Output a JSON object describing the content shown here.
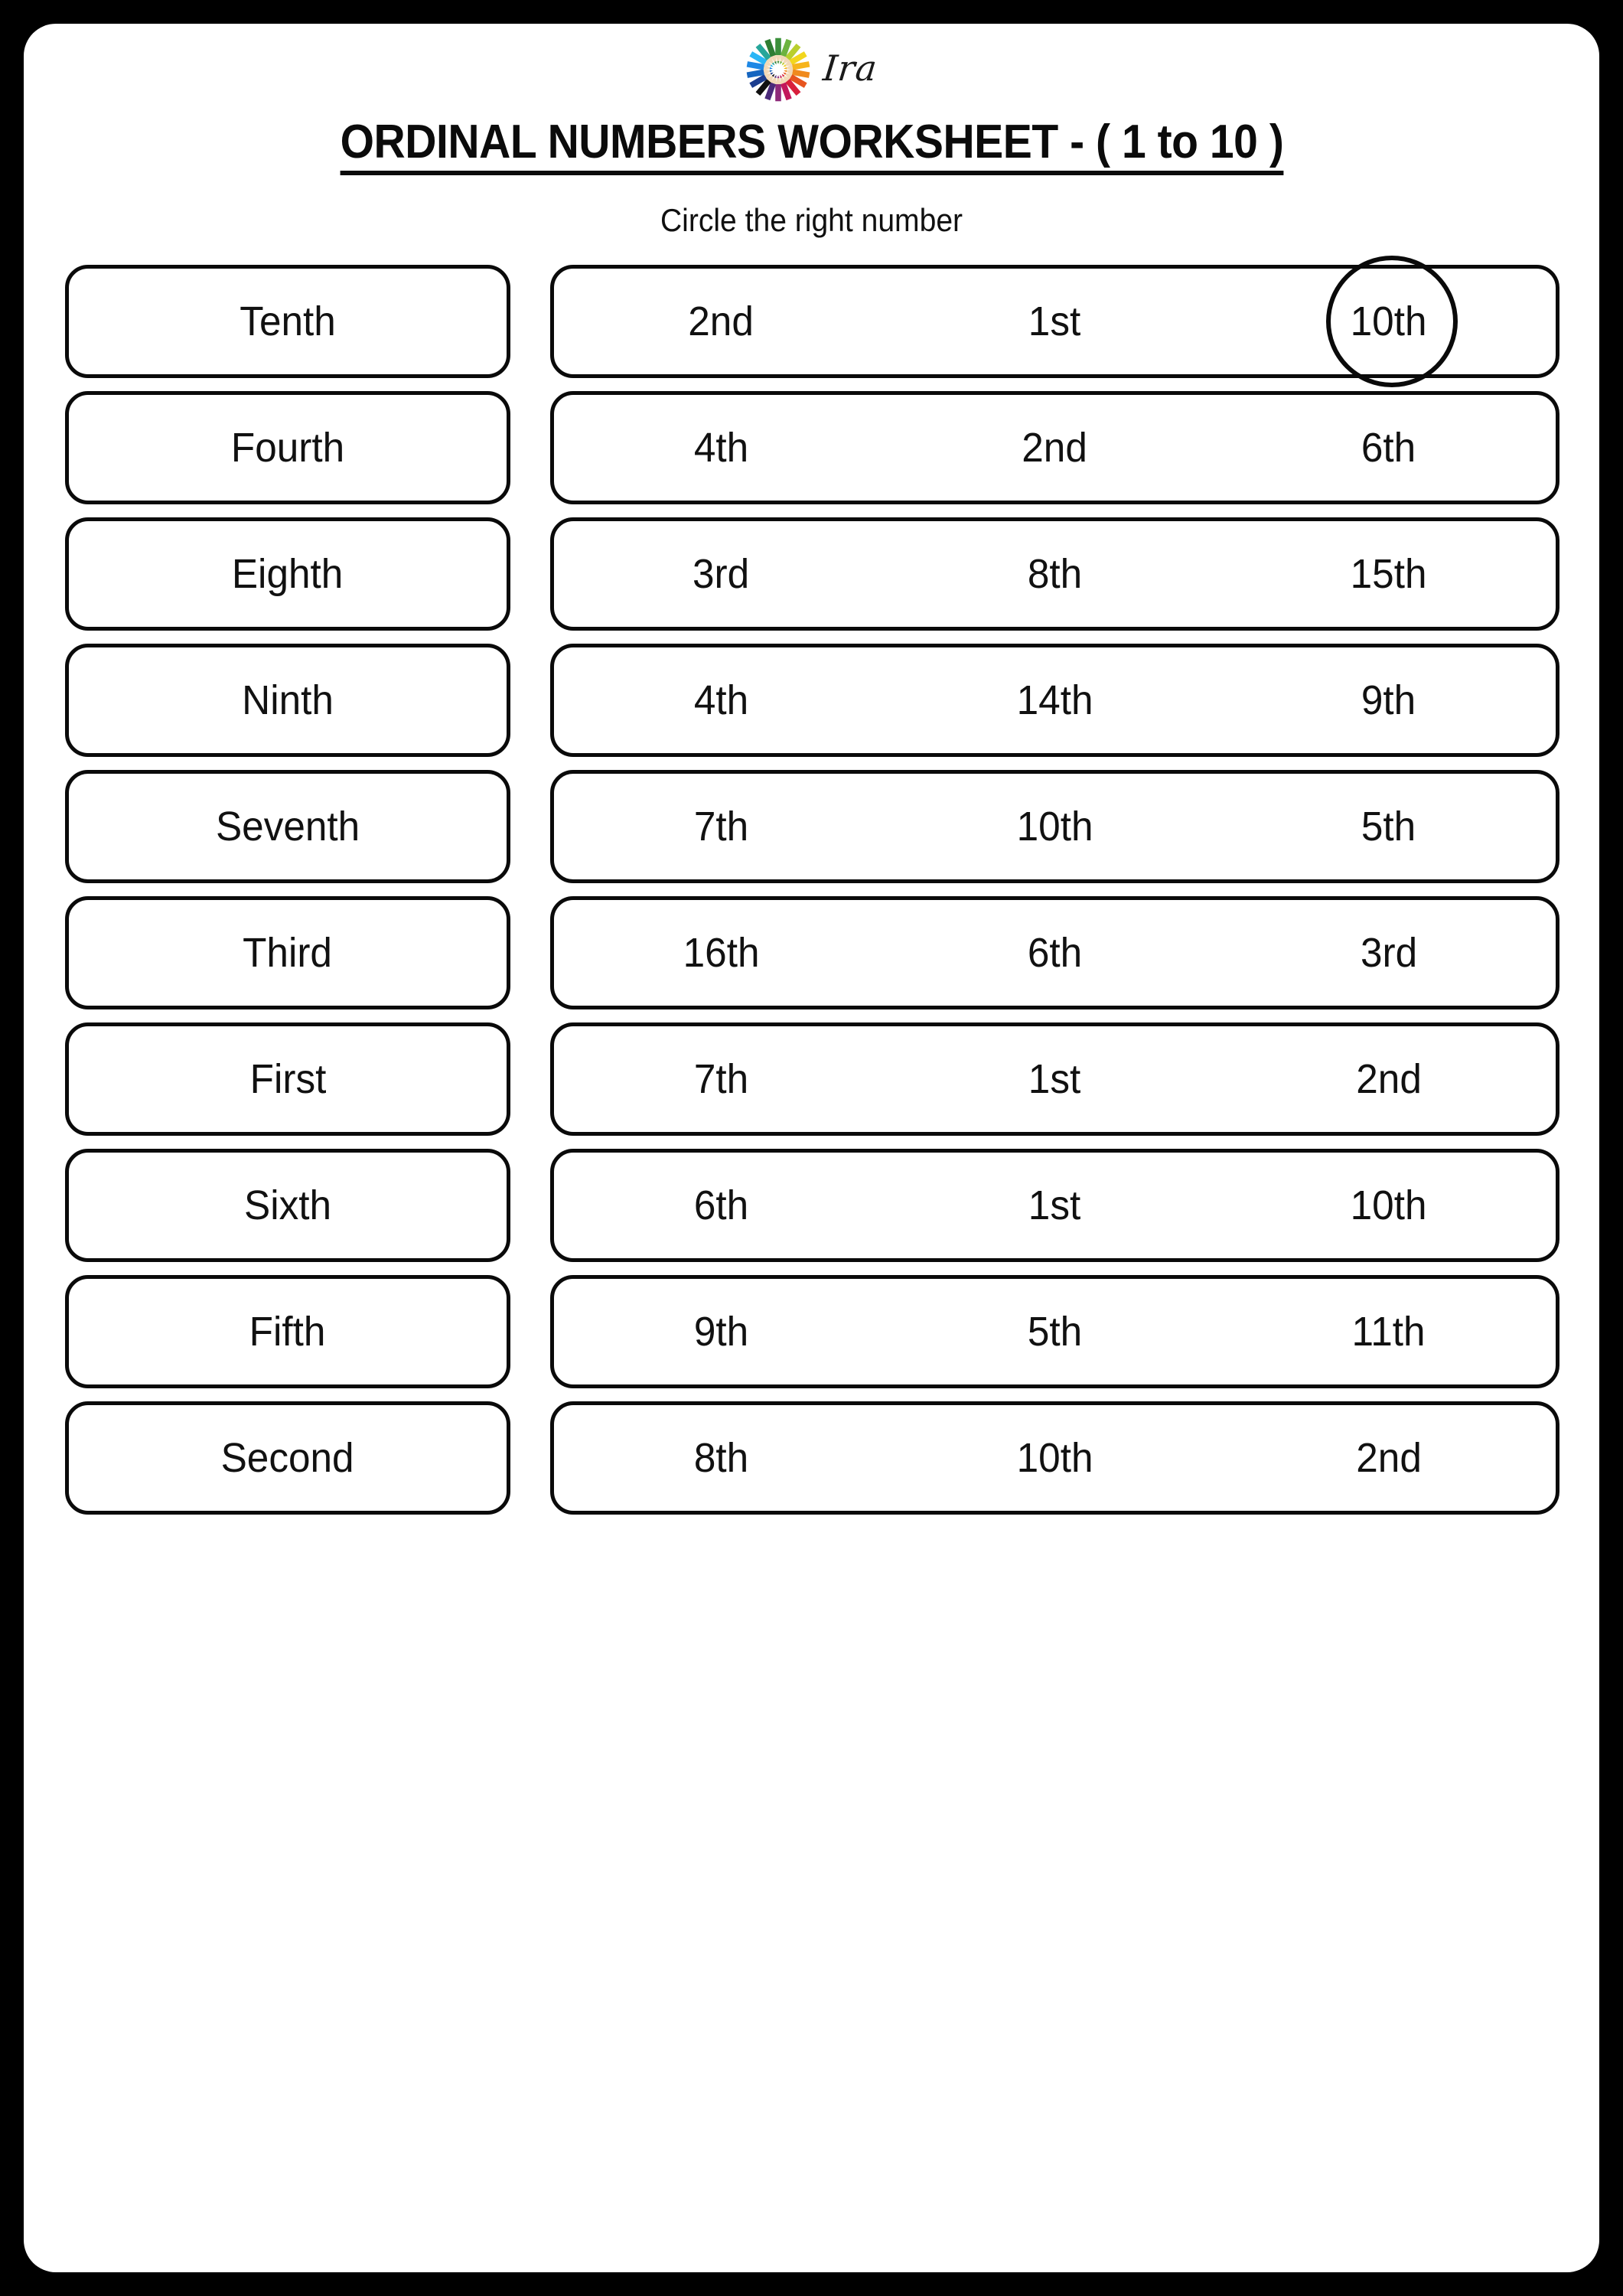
{
  "brand": {
    "name": "Ira",
    "logo_icon": "color-pencils-circle-logo"
  },
  "header": {
    "title": "ORDINAL NUMBERS WORKSHEET - ( 1 to 10 )",
    "subtitle": "Circle the right number"
  },
  "colors": {
    "page_background": "#000000",
    "sheet_background": "#ffffff",
    "ink": "#0a0a0a"
  },
  "rows": [
    {
      "word": "Tenth",
      "options": [
        "2nd",
        "1st",
        "10th"
      ],
      "circled_index": 2
    },
    {
      "word": "Fourth",
      "options": [
        "4th",
        "2nd",
        "6th"
      ],
      "circled_index": -1
    },
    {
      "word": "Eighth",
      "options": [
        "3rd",
        "8th",
        "15th"
      ],
      "circled_index": -1
    },
    {
      "word": "Ninth",
      "options": [
        "4th",
        "14th",
        "9th"
      ],
      "circled_index": -1
    },
    {
      "word": "Seventh",
      "options": [
        "7th",
        "10th",
        "5th"
      ],
      "circled_index": -1
    },
    {
      "word": "Third",
      "options": [
        "16th",
        "6th",
        "3rd"
      ],
      "circled_index": -1
    },
    {
      "word": "First",
      "options": [
        "7th",
        "1st",
        "2nd"
      ],
      "circled_index": -1
    },
    {
      "word": "Sixth",
      "options": [
        "6th",
        "1st",
        "10th"
      ],
      "circled_index": -1
    },
    {
      "word": "Fifth",
      "options": [
        "9th",
        "5th",
        "11th"
      ],
      "circled_index": -1
    },
    {
      "word": "Second",
      "options": [
        "8th",
        "10th",
        "2nd"
      ],
      "circled_index": -1
    }
  ]
}
